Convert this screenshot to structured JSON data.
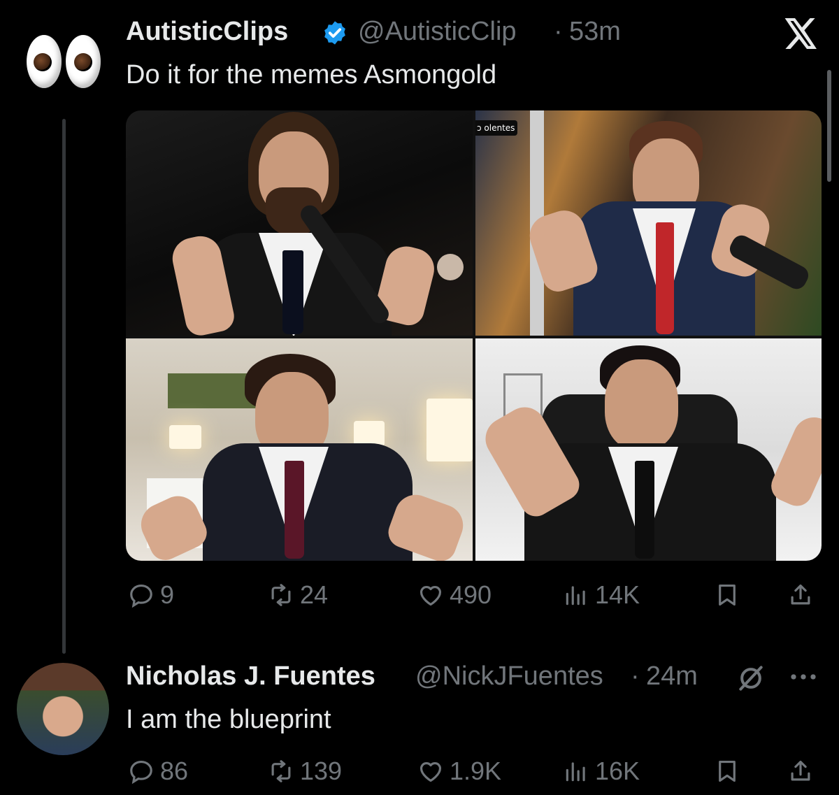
{
  "tweet1": {
    "display_name": "AutisticClips",
    "handle": "@AutisticClip",
    "separator": "·",
    "time": "53m",
    "text": "Do it for the memes Asmongold",
    "media_overlay": "ɔ olentes",
    "stats": {
      "replies": "9",
      "reposts": "24",
      "likes": "490",
      "views": "14K"
    }
  },
  "tweet2": {
    "display_name": "Nicholas J. Fuentes",
    "handle": "@NickJFuentes",
    "separator": "·",
    "time": "24m",
    "text": "I am the blueprint",
    "stats": {
      "replies": "86",
      "reposts": "139",
      "likes": "1.9K",
      "views": "16K"
    }
  },
  "colors": {
    "background": "#000000",
    "text": "#e7e9ea",
    "muted": "#71767b",
    "verified": "#1d9bf0"
  },
  "icons": [
    "eyes-emoji-avatar",
    "verified-badge-icon",
    "x-logo-icon",
    "reply-icon",
    "repost-icon",
    "like-icon",
    "views-icon",
    "bookmark-icon",
    "share-icon",
    "more-icon",
    "grok-slash-icon"
  ]
}
